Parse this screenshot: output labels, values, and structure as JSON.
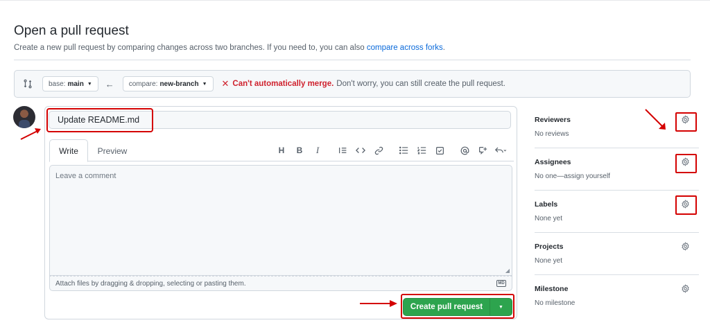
{
  "header": {
    "title": "Open a pull request",
    "subtitle_text": "Create a new pull request by comparing changes across two branches. If you need to, you can also",
    "subtitle_link": "compare across forks",
    "subtitle_end": "."
  },
  "compare_bar": {
    "base_prefix": "base:",
    "base_branch": "main",
    "compare_prefix": "compare:",
    "compare_branch": "new-branch",
    "merge_status": "Can't automatically merge.",
    "merge_note": "Don't worry, you can still create the pull request."
  },
  "editor": {
    "title_value": "Update README.md",
    "tab_write": "Write",
    "tab_preview": "Preview",
    "comment_placeholder": "Leave a comment",
    "attach_text": "Attach files by dragging & dropping, selecting or pasting them.",
    "markdown_badge": "MD",
    "toolbar_icons": [
      "heading-icon",
      "bold-icon",
      "italic-icon",
      "quote-icon",
      "code-icon",
      "link-icon",
      "unordered-list-icon",
      "ordered-list-icon",
      "task-list-icon",
      "mention-icon",
      "cross-reference-icon",
      "reply-icon"
    ],
    "toolbar_glyphs": {
      "heading": "H",
      "bold": "B",
      "italic": "I"
    },
    "create_button": "Create pull request"
  },
  "sidebar": {
    "sections": [
      {
        "heading": "Reviewers",
        "value": "No reviews"
      },
      {
        "heading": "Assignees",
        "value": "No one—assign yourself"
      },
      {
        "heading": "Labels",
        "value": "None yet"
      },
      {
        "heading": "Projects",
        "value": "None yet"
      },
      {
        "heading": "Milestone",
        "value": "No milestone"
      }
    ]
  },
  "colors": {
    "primary_button": "#2da44e",
    "link": "#0969da",
    "error": "#cf222e",
    "annotation_red": "#d40000"
  }
}
